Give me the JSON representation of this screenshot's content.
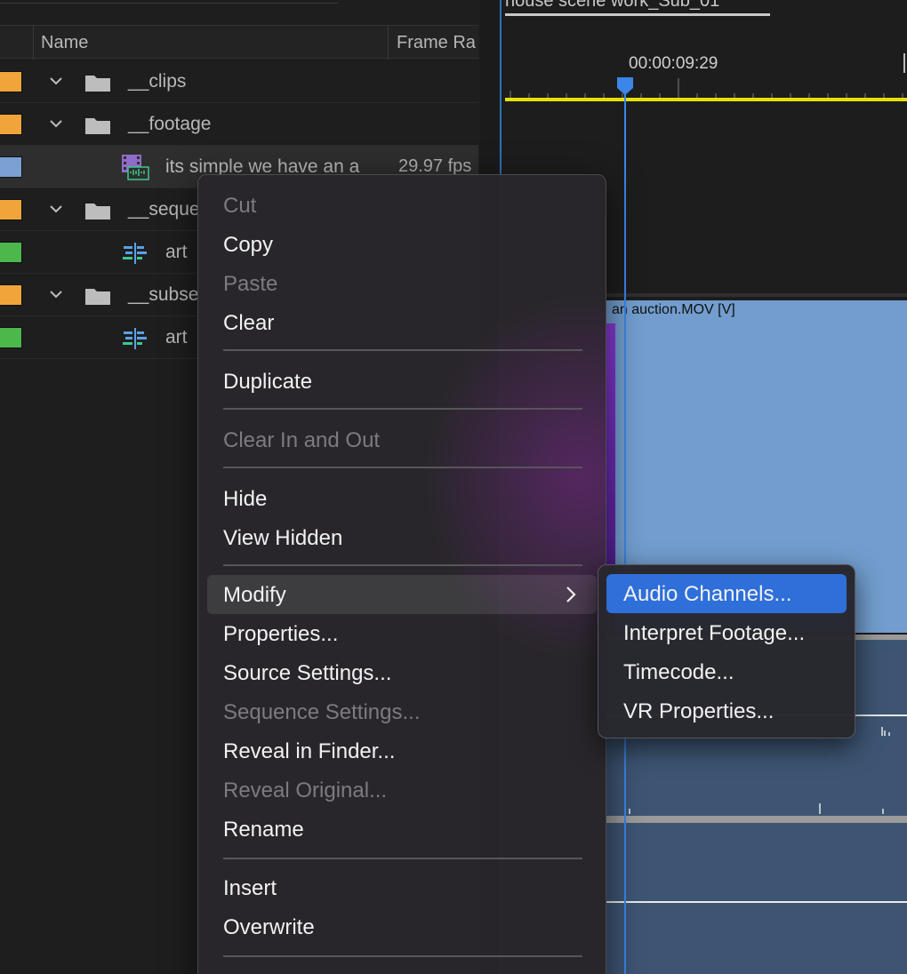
{
  "project": {
    "columns": {
      "name": "Name",
      "frame_rate": "Frame Ra"
    },
    "rows": [
      {
        "label": "__clips",
        "swatch": "#f0a43a",
        "type": "folder",
        "rate": ""
      },
      {
        "label": "__footage",
        "swatch": "#f0a43a",
        "type": "folder",
        "rate": ""
      },
      {
        "label": "its simple we have an a",
        "swatch": "#7aa0d4",
        "type": "clip",
        "rate": "29.97 fps"
      },
      {
        "label": "__seque",
        "swatch": "#f0a43a",
        "type": "folder",
        "rate": ""
      },
      {
        "label": "art",
        "swatch": "#4cb84c",
        "type": "sequence",
        "rate": ""
      },
      {
        "label": "__subse",
        "swatch": "#f0a43a",
        "type": "folder",
        "rate": ""
      },
      {
        "label": "art",
        "swatch": "#4cb84c",
        "type": "sequence",
        "rate": ""
      }
    ]
  },
  "timeline": {
    "sequence_tab": "house scene work_Sub_01",
    "timecode": "00:00:09:29",
    "clip_title": "an auction.MOV [V]"
  },
  "context_menu": {
    "items": [
      {
        "label": "Cut",
        "disabled": true
      },
      {
        "label": "Copy",
        "disabled": false
      },
      {
        "label": "Paste",
        "disabled": true
      },
      {
        "label": "Clear",
        "disabled": false
      },
      {
        "label": "Duplicate",
        "disabled": false
      },
      {
        "label": "Clear In and Out",
        "disabled": true
      },
      {
        "label": "Hide",
        "disabled": false
      },
      {
        "label": "View Hidden",
        "disabled": false
      },
      {
        "label": "Modify",
        "disabled": false,
        "submenu": true
      },
      {
        "label": "Properties...",
        "disabled": false
      },
      {
        "label": "Source Settings...",
        "disabled": false
      },
      {
        "label": "Sequence Settings...",
        "disabled": true
      },
      {
        "label": "Reveal in Finder...",
        "disabled": false
      },
      {
        "label": "Reveal Original...",
        "disabled": true
      },
      {
        "label": "Rename",
        "disabled": false
      },
      {
        "label": "Insert",
        "disabled": false
      },
      {
        "label": "Overwrite",
        "disabled": false
      }
    ]
  },
  "submenu": {
    "items": [
      {
        "label": "Audio Channels..."
      },
      {
        "label": "Interpret Footage..."
      },
      {
        "label": "Timecode..."
      },
      {
        "label": "VR Properties..."
      }
    ]
  },
  "colors": {
    "accent_blue": "#2e6fd9",
    "playhead": "#3b86e8",
    "in_out_bar": "#e6e10a",
    "video_clip": "#729dce",
    "audio_track": "#3d5573"
  }
}
